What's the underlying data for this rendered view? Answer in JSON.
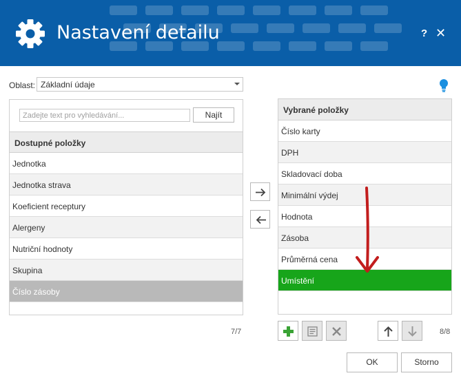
{
  "window": {
    "title": "Nastavení detailu",
    "help_label": "?",
    "close_label": "✕",
    "header_color": "#0a5ea8"
  },
  "oblast": {
    "label": "Oblast:",
    "value": "Základní údaje"
  },
  "left": {
    "search_placeholder": "Zadejte text pro vyhledávání...",
    "find_label": "Najít",
    "header": "Dostupné položky",
    "items": [
      "Jednotka",
      "Jednotka strava",
      "Koeficient receptury",
      "Alergeny",
      "Nutriční hodnoty",
      "Skupina",
      "Číslo zásoby"
    ],
    "count": "7/7"
  },
  "right": {
    "header": "Vybrané položky",
    "items": [
      "Číslo karty",
      "DPH",
      "Skladovací doba",
      "Minimální výdej",
      "Hodnota",
      "Zásoba",
      "Průměrná cena",
      "Umístění"
    ],
    "count": "8/8",
    "selected_color": "#17a51a"
  },
  "buttons": {
    "ok": "OK",
    "cancel": "Storno"
  }
}
